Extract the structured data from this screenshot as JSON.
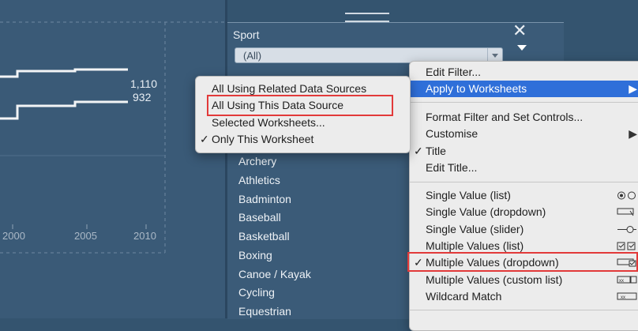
{
  "chart": {
    "series_labels": [
      "1,110",
      "932"
    ],
    "x_ticks": [
      "2000",
      "2005",
      "2010"
    ]
  },
  "filter": {
    "title": "Sport",
    "dropdown_value": "(All)",
    "items": [
      "Archery",
      "Athletics",
      "Badminton",
      "Baseball",
      "Basketball",
      "Boxing",
      "Canoe / Kayak",
      "Cycling",
      "Equestrian"
    ]
  },
  "context_menu": {
    "edit_filter": "Edit Filter...",
    "apply_to_worksheets": "Apply to Worksheets",
    "format_filter": "Format Filter and Set Controls...",
    "customise": "Customise",
    "title": "Title",
    "edit_title": "Edit Title...",
    "single_value_list": "Single Value (list)",
    "single_value_dropdown": "Single Value (dropdown)",
    "single_value_slider": "Single Value (slider)",
    "multiple_values_list": "Multiple Values (list)",
    "multiple_values_dropdown": "Multiple Values (dropdown)",
    "multiple_values_custom_list": "Multiple Values (custom list)",
    "wildcard_match": "Wildcard Match"
  },
  "submenu": {
    "related": "All Using Related Data Sources",
    "this_source": "All Using This Data Source",
    "selected": "Selected Worksheets...",
    "only_this": "Only This Worksheet"
  },
  "colors": {
    "background": "#34546f",
    "highlight": "#2f6fd9",
    "red_outline": "#e23a3a"
  }
}
